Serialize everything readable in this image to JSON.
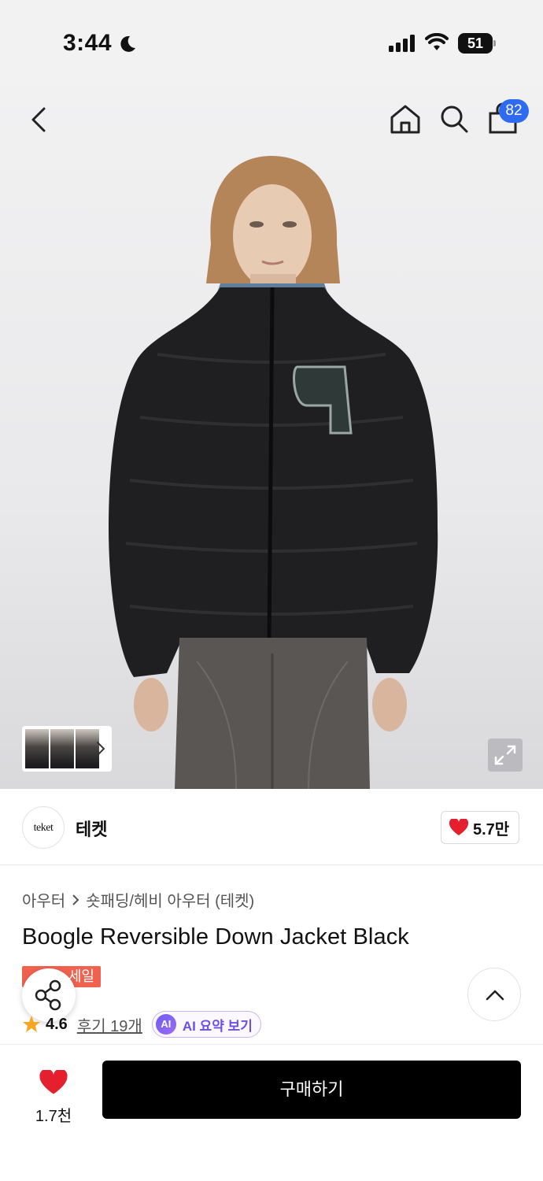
{
  "status_bar": {
    "time": "3:44",
    "battery": "51"
  },
  "header": {
    "cart_count": "82"
  },
  "hero": {
    "image_alt": "Model wearing black reversible puffer down jacket"
  },
  "brand": {
    "logo_text": "teket",
    "name": "테켓",
    "likes": "5.7만"
  },
  "breadcrumb": {
    "category": "아우터",
    "subcategory": "숏패딩/헤비 아우터 (테켓)"
  },
  "product": {
    "title": "Boogle Reversible Down Jacket Black",
    "sale_badge": "세일"
  },
  "rating": {
    "value": "4.6",
    "reviews": "후기 19개",
    "ai_badge": "AI",
    "ai_label": "AI 요약 보기"
  },
  "bottom_bar": {
    "wish_count": "1.7천",
    "buy_label": "구매하기"
  },
  "colors": {
    "accent_blue": "#2f6bf0",
    "sale_red": "#f0624e",
    "heart_red": "#e5202e",
    "star": "#f5a623",
    "ai_purple": "#6a4fe8"
  },
  "icons": [
    "moon-icon",
    "signal-icon",
    "wifi-icon",
    "battery-icon",
    "back-arrow-icon",
    "home-icon",
    "search-icon",
    "bag-icon",
    "chevron-right-icon",
    "expand-icon",
    "heart-icon",
    "share-icon",
    "chevron-up-icon",
    "star-icon"
  ]
}
